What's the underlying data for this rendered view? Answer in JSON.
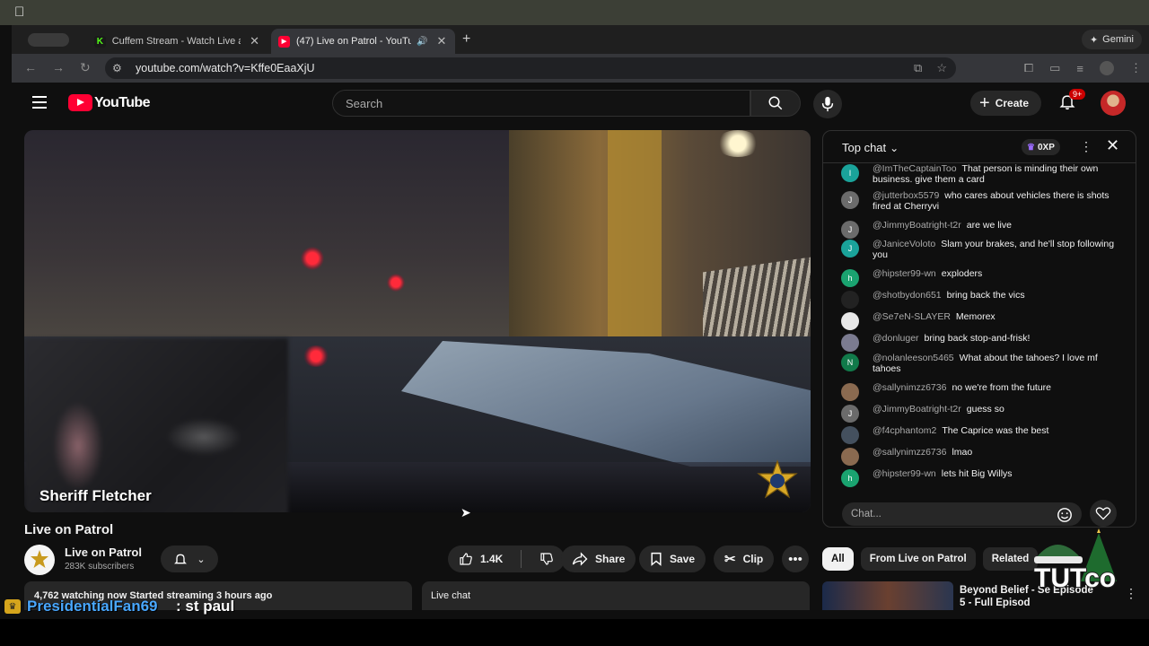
{
  "browser": {
    "tabs": [
      {
        "title": "Cuffem Stream - Watch Live a",
        "active": false
      },
      {
        "title": "(47) Live on Patrol - YouTu",
        "active": true
      }
    ],
    "gemini_label": "Gemini",
    "url": "youtube.com/watch?v=Kffe0EaaXjU"
  },
  "header": {
    "logo_text": "YouTube",
    "search_placeholder": "Search",
    "create_label": "Create",
    "notification_count": "9+"
  },
  "video": {
    "overlay_name": "Sheriff Fletcher",
    "title": "Live on Patrol",
    "channel_name": "Live on Patrol",
    "subscribers": "283K subscribers",
    "like_count": "1.4K",
    "share_label": "Share",
    "save_label": "Save",
    "clip_label": "Clip",
    "description_line": "4,762 watching now  Started streaming 3 hours ago",
    "live_chat_label": "Live chat"
  },
  "chat": {
    "mode_label": "Top chat",
    "xp_label": "0XP",
    "input_placeholder": "Chat...",
    "messages": [
      {
        "initial": "I",
        "color": "#1aa39a",
        "author": "@ImTheCaptainToo",
        "text": "That person is minding their own business. give them a card"
      },
      {
        "initial": "J",
        "color": "#6b6b6b",
        "author": "@jutterbox5579",
        "text": "who cares about vehicles there is shots fired at Cherryvi"
      },
      {
        "initial": "J",
        "color": "#6b6b6b",
        "author": "@JimmyBoatright-t2r",
        "text": "are we live"
      },
      {
        "initial": "J",
        "color": "#1aa39a",
        "author": "@JaniceVoloto",
        "text": "Slam your brakes, and he'll stop following you"
      },
      {
        "initial": "h",
        "color": "#1aa370",
        "author": "@hipster99-wn",
        "text": "exploders"
      },
      {
        "initial": "",
        "color": "#222222",
        "author": "@shotbydon651",
        "text": "bring back the vics"
      },
      {
        "initial": "",
        "color": "#e8e8e8",
        "author": "@Se7eN-SLAYER",
        "text": "Memorex"
      },
      {
        "initial": "",
        "color": "#7b7b90",
        "author": "@donluger",
        "text": "bring back stop-and-frisk!"
      },
      {
        "initial": "N",
        "color": "#117a4a",
        "author": "@nolanleeson5465",
        "text": "What about the tahoes? I love mf tahoes"
      },
      {
        "initial": "",
        "color": "#8a6a50",
        "author": "@sallynimzz6736",
        "text": "no we're from the future"
      },
      {
        "initial": "J",
        "color": "#6b6b6b",
        "author": "@JimmyBoatright-t2r",
        "text": "guess so"
      },
      {
        "initial": "",
        "color": "#44505e",
        "author": "@f4cphantom2",
        "text": "The Caprice was the best"
      },
      {
        "initial": "",
        "color": "#8a6a50",
        "author": "@sallynimzz6736",
        "text": "lmao"
      },
      {
        "initial": "h",
        "color": "#1aa370",
        "author": "@hipster99-wn",
        "text": "lets hit Big Willys"
      }
    ]
  },
  "recommendations": {
    "chips": [
      "All",
      "From Live on Patrol",
      "Related"
    ],
    "first_title": "Beyond Belief - Se Episode 5 - Full Episod"
  },
  "stream_overlay": {
    "viewer_name": "PresidentialFan69",
    "message": ": st paul",
    "watermark": "TUTco"
  }
}
